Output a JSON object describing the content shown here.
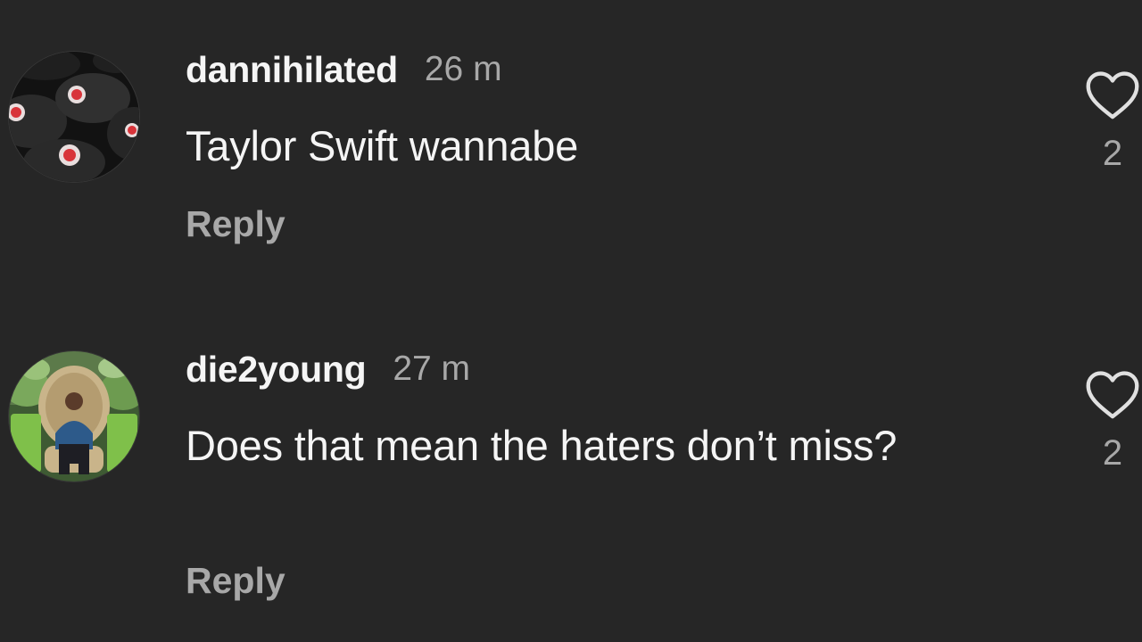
{
  "comments": [
    {
      "username": "dannihilated",
      "time": "26 m",
      "text": "Taylor Swift wannabe",
      "reply_label": "Reply",
      "likes": "2",
      "avatar_icon": "dark-plates-avatar",
      "like_icon": "heart-outline-icon"
    },
    {
      "username": "die2young",
      "time": "27 m",
      "text": "Does that mean the haters don’t miss?",
      "reply_label": "Reply",
      "likes": "2",
      "avatar_icon": "man-in-wicker-chair-avatar",
      "like_icon": "heart-outline-icon"
    }
  ],
  "colors": {
    "background": "#262626",
    "primary_text": "#f5f5f5",
    "secondary_text": "#a8a8a8"
  }
}
